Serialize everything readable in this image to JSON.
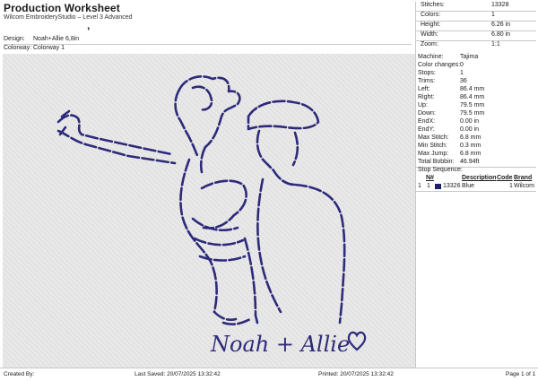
{
  "header": {
    "title": "Production Worksheet",
    "subtitle": "Wilcom EmbroideryStudio – Level 3 Advanced",
    "apostrophe": "’"
  },
  "design": {
    "label": "Design:",
    "value": "Noah+Allie 6,8in",
    "colorway_label": "Colorway:",
    "colorway_value": "Colorway 1"
  },
  "summary": [
    {
      "label": "Stitches:",
      "value": "13328"
    },
    {
      "label": "Colors:",
      "value": "1"
    },
    {
      "label": "Height:",
      "value": "6.26 in"
    },
    {
      "label": "Width:",
      "value": "6.80 in"
    },
    {
      "label": "Zoom:",
      "value": "1:1"
    }
  ],
  "machine_info": [
    {
      "label": "Machine:",
      "value": "Tajima"
    },
    {
      "label": "Color changes:",
      "value": "0"
    },
    {
      "label": "Stops:",
      "value": "1"
    },
    {
      "label": "Trims:",
      "value": "36"
    },
    {
      "label": "Left:",
      "value": "86.4 mm"
    },
    {
      "label": "Right:",
      "value": "86.4 mm"
    },
    {
      "label": "Up:",
      "value": "79.5 mm"
    },
    {
      "label": "Down:",
      "value": "79.5 mm"
    },
    {
      "label": "EndX:",
      "value": "0.00 in"
    },
    {
      "label": "EndY:",
      "value": "0.00 in"
    },
    {
      "label": "Max Stitch:",
      "value": "6.8 mm"
    },
    {
      "label": "Min Stitch:",
      "value": "0.3 mm"
    },
    {
      "label": "Max Jump:",
      "value": "6.8 mm"
    },
    {
      "label": "Total Bobbin:",
      "value": "46.94ft"
    }
  ],
  "stop_sequence": {
    "label": "Stop Sequence:",
    "headers": {
      "n": "N#",
      "desc": "Description",
      "code": "Code",
      "brand": "Brand"
    },
    "rows": [
      {
        "idx": "1",
        "n": "1",
        "stitches": "13326",
        "desc": "Blue",
        "code": "1",
        "brand": "Wilcom",
        "color": "#1d1f6b"
      }
    ]
  },
  "artwork": {
    "caption": "Noah + Allie",
    "heart_icon": "heart-outline-icon",
    "thread_color": "#2d2a7a"
  },
  "footer": {
    "created_by": "Created By:",
    "last_saved": "Last Saved: 20/07/2025 13:32:42",
    "printed": "Printed: 20/07/2025 13:32:42",
    "page": "Page 1 of 1"
  }
}
